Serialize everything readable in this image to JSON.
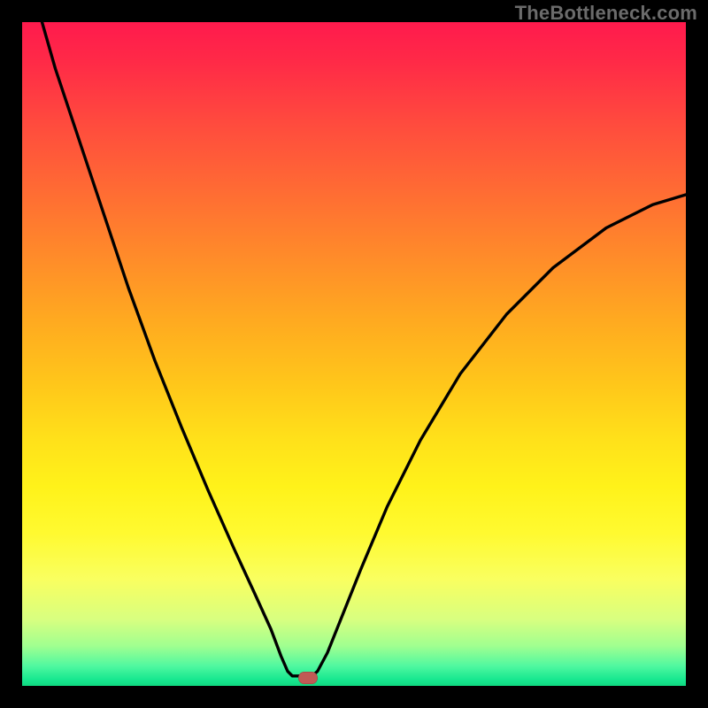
{
  "watermark": "TheBottleneck.com",
  "colors": {
    "curve_stroke": "#000000",
    "marker_fill": "#c05a55",
    "frame_bg": "#000000"
  },
  "chart_data": {
    "type": "line",
    "title": "",
    "xlabel": "",
    "ylabel": "",
    "xlim": [
      0,
      100
    ],
    "ylim": [
      0,
      100
    ],
    "grid": false,
    "curve_points": [
      {
        "x": 3.0,
        "y": 100.0
      },
      {
        "x": 5.0,
        "y": 93.0
      },
      {
        "x": 8.0,
        "y": 84.0
      },
      {
        "x": 12.0,
        "y": 72.0
      },
      {
        "x": 16.0,
        "y": 60.0
      },
      {
        "x": 20.0,
        "y": 49.0
      },
      {
        "x": 24.0,
        "y": 39.0
      },
      {
        "x": 28.0,
        "y": 29.5
      },
      {
        "x": 32.0,
        "y": 20.5
      },
      {
        "x": 35.0,
        "y": 14.0
      },
      {
        "x": 37.5,
        "y": 8.5
      },
      {
        "x": 39.0,
        "y": 4.5
      },
      {
        "x": 40.0,
        "y": 2.2
      },
      {
        "x": 40.7,
        "y": 1.5
      },
      {
        "x": 43.7,
        "y": 1.5
      },
      {
        "x": 44.5,
        "y": 2.2
      },
      {
        "x": 46.0,
        "y": 5.0
      },
      {
        "x": 48.0,
        "y": 10.0
      },
      {
        "x": 51.0,
        "y": 17.5
      },
      {
        "x": 55.0,
        "y": 27.0
      },
      {
        "x": 60.0,
        "y": 37.0
      },
      {
        "x": 66.0,
        "y": 47.0
      },
      {
        "x": 73.0,
        "y": 56.0
      },
      {
        "x": 80.0,
        "y": 63.0
      },
      {
        "x": 88.0,
        "y": 69.0
      },
      {
        "x": 95.0,
        "y": 72.5
      },
      {
        "x": 100.0,
        "y": 74.0
      }
    ],
    "marker": {
      "x": 43.0,
      "y": 1.2
    }
  }
}
